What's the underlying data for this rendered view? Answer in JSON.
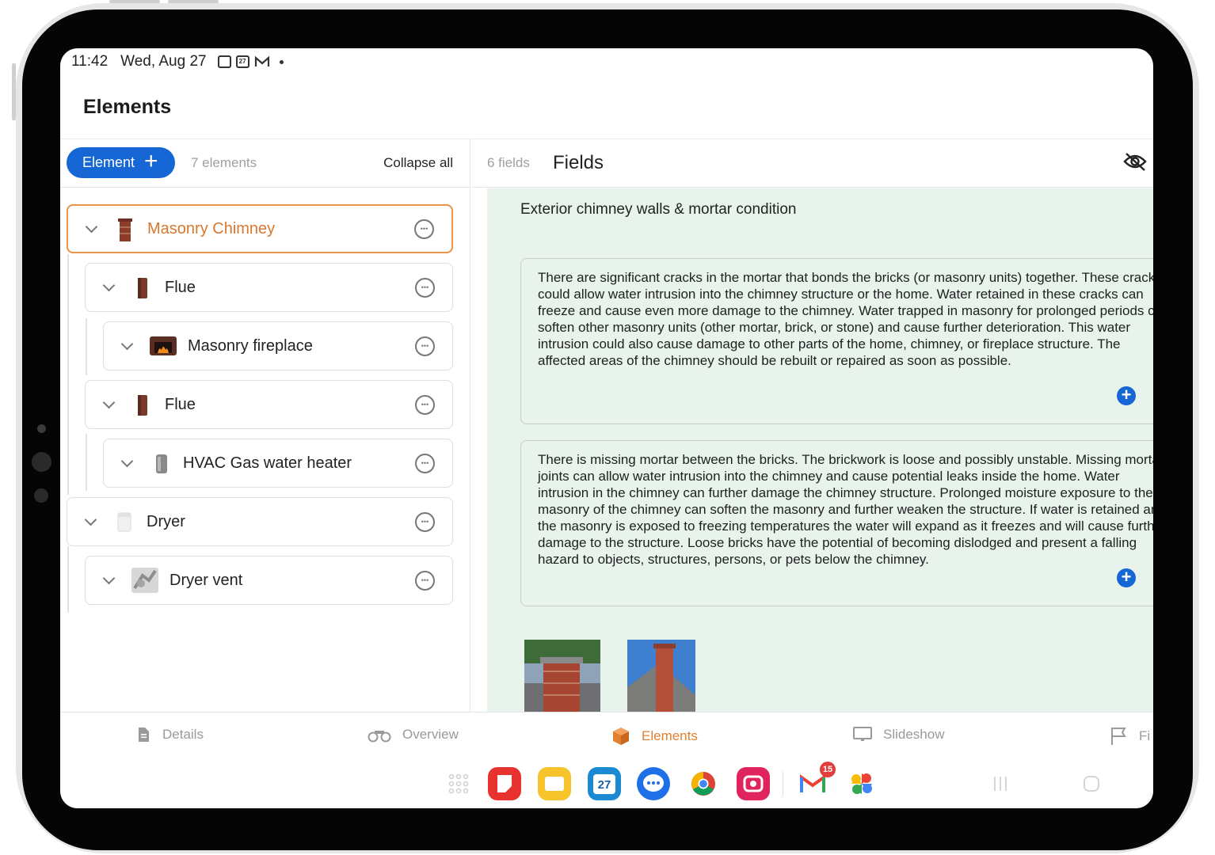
{
  "status": {
    "time": "11:42",
    "date": "Wed, Aug 27",
    "calendar_day": "27"
  },
  "page": {
    "title": "Elements"
  },
  "left_toolbar": {
    "add_label": "Element",
    "count": "7 elements",
    "collapse": "Collapse all"
  },
  "elements": [
    {
      "label": "Masonry Chimney"
    },
    {
      "label": "Flue"
    },
    {
      "label": "Masonry fireplace"
    },
    {
      "label": "Flue"
    },
    {
      "label": "HVAC Gas water heater"
    },
    {
      "label": "Dryer"
    },
    {
      "label": "Dryer vent"
    }
  ],
  "fields": {
    "count": "6 fields",
    "title": "Fields",
    "section": "Exterior chimney walls & mortar condition",
    "comments": [
      "There are significant cracks in the mortar that bonds the bricks (or masonry units) together. These cracks could allow water intrusion into the chimney structure or the home. Water retained in these cracks can freeze and cause even more damage to the chimney. Water trapped in masonry for prolonged periods can soften other masonry units (other mortar, brick, or stone) and cause further deterioration. This water intrusion could also cause damage to other parts of the home, chimney, or fireplace structure. The affected areas of the chimney should be rebuilt or repaired as soon as possible.",
      "There is missing mortar between the bricks. The brickwork is loose and possibly unstable. Missing mortar joints can allow water intrusion into the chimney and cause potential leaks inside the home. Water intrusion in the chimney can further damage the chimney structure. Prolonged moisture exposure to the masonry of the chimney can soften the masonry and further weaken the structure. If water is retained and the masonry is exposed to freezing temperatures the water will expand as it freezes and will cause further damage to the structure. Loose bricks have the potential of becoming dislodged and present a falling hazard to objects, structures, persons, or pets below the chimney."
    ]
  },
  "tabs": [
    {
      "label": "Details",
      "icon": "document-icon"
    },
    {
      "label": "Overview",
      "icon": "binoculars-icon"
    },
    {
      "label": "Elements",
      "icon": "cube-icon"
    },
    {
      "label": "Slideshow",
      "icon": "monitor-icon"
    },
    {
      "label": "Fi",
      "icon": "flag-icon"
    }
  ],
  "dock": {
    "gmail_badge": "15",
    "calendar_day": "27"
  },
  "colors": {
    "accent": "#1766d6",
    "active_tab": "#e2802f",
    "selected_border": "#e8954b",
    "fields_bg": "#e8f3ec"
  }
}
